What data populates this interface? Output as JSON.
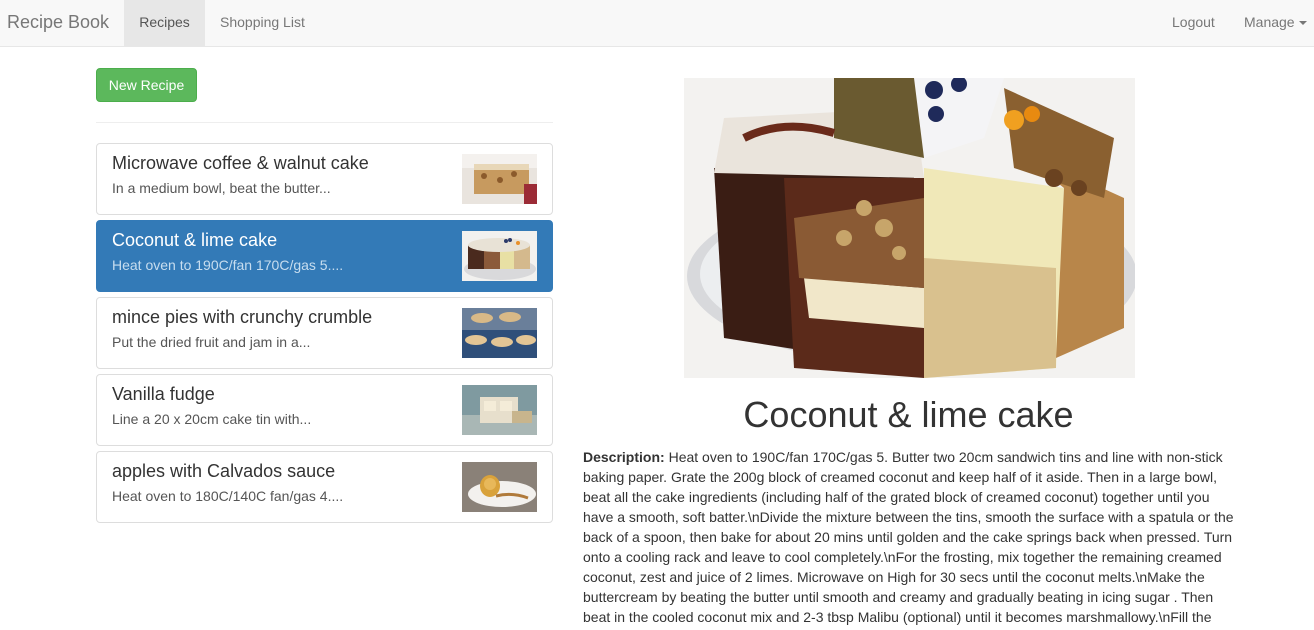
{
  "navbar": {
    "brand": "Recipe Book",
    "links": [
      "Recipes",
      "Shopping List"
    ],
    "right": {
      "logout": "Logout",
      "manage": "Manage"
    }
  },
  "actions": {
    "new_recipe": "New Recipe"
  },
  "recipes": [
    {
      "title": "Microwave coffee & walnut cake",
      "desc": "In a medium bowl, beat the butter...",
      "active": false
    },
    {
      "title": "Coconut & lime cake",
      "desc": "Heat oven to 190C/fan 170C/gas 5....",
      "active": true
    },
    {
      "title": "mince pies with crunchy crumble",
      "desc": "Put the dried fruit and jam in a...",
      "active": false
    },
    {
      "title": "Vanilla fudge",
      "desc": "Line a 20 x 20cm cake tin with...",
      "active": false
    },
    {
      "title": "apples with Calvados sauce",
      "desc": "Heat oven to 180C/140C fan/gas 4....",
      "active": false
    }
  ],
  "detail": {
    "title": "Coconut & lime cake",
    "desc_label": "Description:",
    "description": "Heat oven to 190C/fan 170C/gas 5. Butter two 20cm sandwich tins and line with non-stick baking paper. Grate the 200g block of creamed coconut and keep half of it aside. Then in a large bowl, beat all the cake ingredients (including half of the grated block of creamed coconut) together until you have a smooth, soft batter.\\nDivide the mixture between the tins, smooth the surface with a spatula or the back of a spoon, then bake for about 20 mins until golden and the cake springs back when pressed. Turn onto a cooling rack and leave to cool completely.\\nFor the frosting, mix together the remaining creamed coconut, zest and juice of 2 limes. Microwave on High for 30 secs until the coconut melts.\\nMake the buttercream by beating the butter until smooth and creamy and gradually beating in icing sugar . Then beat in the cooled coconut mix and 2-3 tbsp Malibu (optional) until it becomes marshmallowy.\\nFill the"
  }
}
